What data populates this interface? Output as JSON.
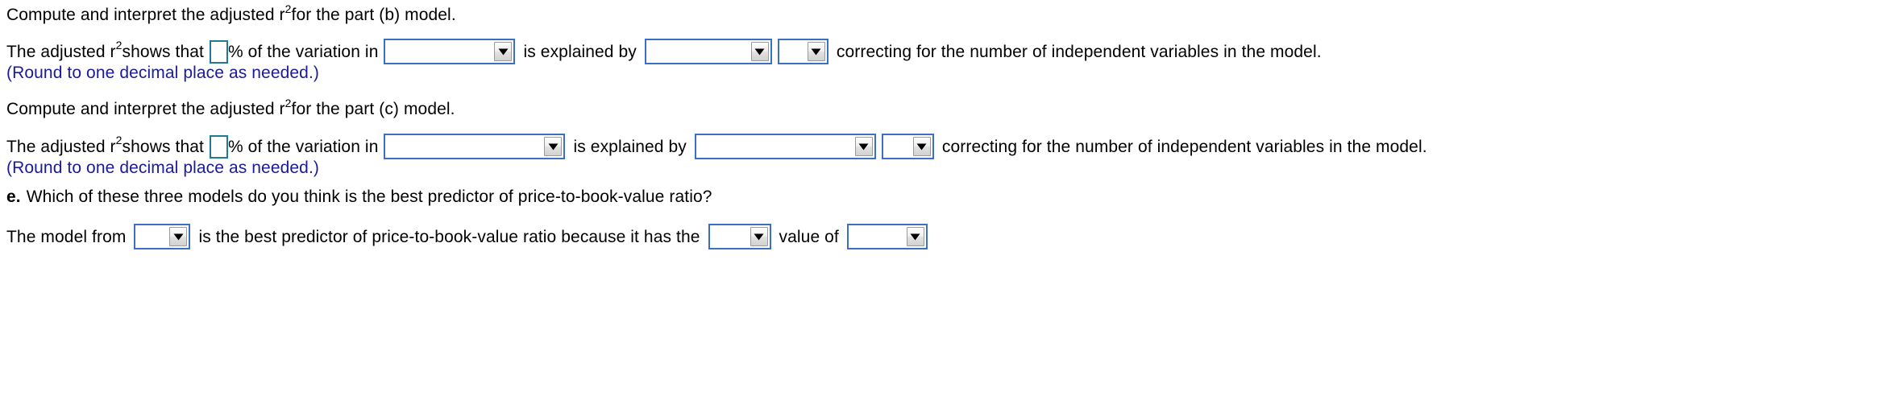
{
  "document": {
    "type": "homework-question",
    "colors": {
      "answer_box_border": "#1f7a96",
      "dropdown_border": "#3a6fc4",
      "note_text": "#1a1a9c",
      "body_text": "#000000",
      "background": "#ffffff"
    }
  },
  "part_b": {
    "prompt_before_r": "Compute and interpret the adjusted r",
    "prompt_superscript": "2",
    "prompt_after_r": " for the part (b) model.",
    "sentence": {
      "s1_before_r": "The adjusted r",
      "s1_superscript": "2",
      "s1_after_r": " shows that",
      "percent_symbol": "% of the variation in",
      "is_explained_by": "is explained by",
      "tail": "correcting for the number of independent variables in the model."
    },
    "answer_box_value": "",
    "dropdown_variation_in": {
      "value": "",
      "name": "variation-in-select"
    },
    "dropdown_explained_by": {
      "value": "",
      "name": "explained-by-select"
    },
    "dropdown_after_adjusting": {
      "value": "",
      "name": "after-adjusting-select"
    },
    "round_note": "(Round to one decimal place as needed.)"
  },
  "part_c": {
    "prompt_before_r": "Compute and interpret the adjusted r",
    "prompt_superscript": "2",
    "prompt_after_r": " for the part (c) model.",
    "sentence": {
      "s1_before_r": "The adjusted r",
      "s1_superscript": "2",
      "s1_after_r": " shows that",
      "percent_symbol": "% of the variation in",
      "is_explained_by": "is explained by",
      "tail": "correcting for the number of independent variables in the model."
    },
    "answer_box_value": "",
    "dropdown_variation_in": {
      "value": "",
      "name": "variation-in-select"
    },
    "dropdown_explained_by": {
      "value": "",
      "name": "explained-by-select"
    },
    "dropdown_after_adjusting": {
      "value": "",
      "name": "after-adjusting-select"
    },
    "round_note": "(Round to one decimal place as needed.)"
  },
  "part_e": {
    "label": "e.",
    "question": "Which of these three models do you think is the best predictor of price-to-book-value ratio?",
    "sentence": {
      "lead": "The model from",
      "middle": "is the best predictor of price-to-book-value ratio because it has the",
      "value_of": "value of"
    },
    "dropdown_model": {
      "value": "",
      "name": "model-select"
    },
    "dropdown_quality": {
      "value": "",
      "name": "quality-select"
    },
    "dropdown_statistic": {
      "value": "",
      "name": "statistic-select"
    }
  },
  "icons": {
    "dropdown_arrow": "chevron-down-icon"
  }
}
